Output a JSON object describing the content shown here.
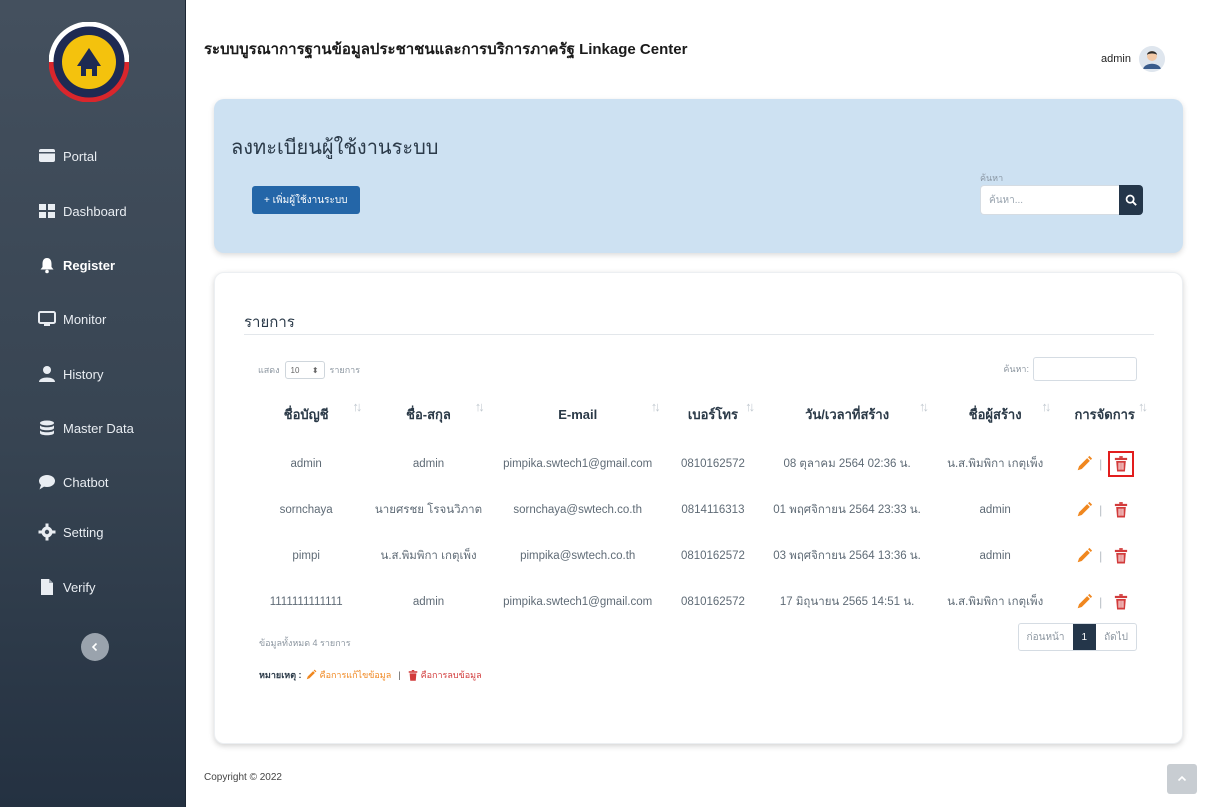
{
  "header": {
    "app_title": "ระบบบูรณาการฐานข้อมูลประชาชนและการบริการภาครัฐ Linkage Center",
    "user_name": "admin"
  },
  "sidebar": {
    "items": [
      {
        "label": "Portal",
        "icon": "portal-icon"
      },
      {
        "label": "Dashboard",
        "icon": "dashboard-icon"
      },
      {
        "label": "Register",
        "icon": "bell-icon",
        "active": true
      },
      {
        "label": "Monitor",
        "icon": "monitor-icon"
      },
      {
        "label": "History",
        "icon": "user-icon"
      },
      {
        "label": "Master Data",
        "icon": "database-icon"
      },
      {
        "label": "Chatbot",
        "icon": "chat-icon"
      },
      {
        "label": "Setting",
        "icon": "gear-icon"
      },
      {
        "label": "Verify",
        "icon": "file-icon"
      }
    ]
  },
  "top_card": {
    "heading": "ลงทะเบียนผู้ใช้งานระบบ",
    "add_button": "+ เพิ่มผู้ใช้งานระบบ",
    "search_label": "ค้นหา",
    "search_placeholder": "ค้นหา..."
  },
  "list": {
    "title": "รายการ",
    "length_prefix": "แสดง",
    "length_value": "10",
    "length_suffix": "รายการ",
    "filter_label": "ค้นหา:",
    "columns": [
      "ชื่อบัญชี",
      "ชื่อ-สกุล",
      "E-mail",
      "เบอร์โทร",
      "วัน/เวลาที่สร้าง",
      "ชื่อผู้สร้าง",
      "การจัดการ"
    ],
    "rows": [
      [
        "admin",
        "admin",
        "pimpika.swtech1@gmail.com",
        "0810162572",
        "08 ตุลาคม 2564 02:36 น.",
        "น.ส.พิมพิกา เกตุเพ็ง"
      ],
      [
        "sornchaya",
        "นายศรชย โรจนวิภาต",
        "sornchaya@swtech.co.th",
        "0814116313",
        "01 พฤศจิกายน 2564 23:33 น.",
        "admin"
      ],
      [
        "pimpi",
        "น.ส.พิมพิกา เกตุเพ็ง",
        "pimpika@swtech.co.th",
        "0810162572",
        "03 พฤศจิกายน 2564 13:36 น.",
        "admin"
      ],
      [
        "1111111111111",
        "admin",
        "pimpika.swtech1@gmail.com",
        "0810162572",
        "17 มิถุนายน 2565 14:51 น.",
        "น.ส.พิมพิกา เกตุเพ็ง"
      ]
    ],
    "summary": "ข้อมูลทั้งหมด 4 รายการ",
    "pager": {
      "prev": "ก่อนหน้า",
      "current": "1",
      "next": "ถัดไป"
    },
    "legend": {
      "label": "หมายเหตุ :",
      "edit": "คือการแก้ไขข้อมูล",
      "sep": "|",
      "delete": "คือการลบข้อมูล"
    }
  },
  "footer": {
    "copyright": "Copyright © 2022"
  },
  "colors": {
    "primary": "#2466a8",
    "dark": "#24364a",
    "edit": "#f0871f",
    "delete": "#d23b3b",
    "highlight": "#e21d1d"
  }
}
